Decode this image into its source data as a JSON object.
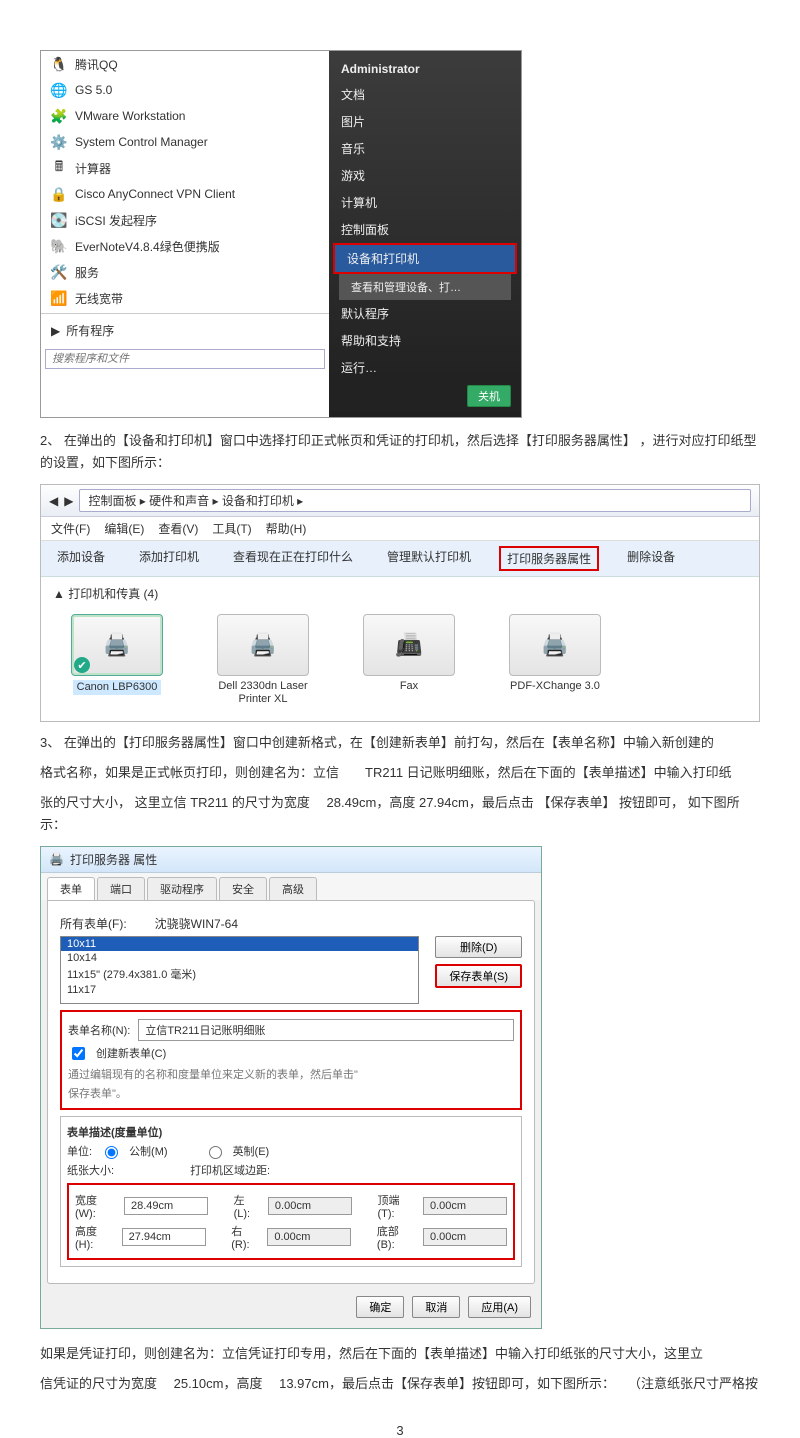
{
  "startmenu": {
    "left": {
      "items": [
        {
          "icon": "🐧",
          "label": "腾讯QQ"
        },
        {
          "icon": "🌐",
          "label": "GS 5.0"
        },
        {
          "icon": "🧩",
          "label": "VMware Workstation"
        },
        {
          "icon": "⚙️",
          "label": "System Control Manager"
        },
        {
          "icon": "🖩",
          "label": "计算器"
        },
        {
          "icon": "🔒",
          "label": "Cisco AnyConnect VPN Client"
        },
        {
          "icon": "💽",
          "label": "iSCSI 发起程序"
        },
        {
          "icon": "🐘",
          "label": "EverNoteV4.8.4绿色便携版"
        },
        {
          "icon": "🛠️",
          "label": "服务"
        },
        {
          "icon": "📶",
          "label": "无线宽带"
        }
      ],
      "allprograms": "所有程序",
      "searchPlaceholder": "搜索程序和文件"
    },
    "right": {
      "user": "Administrator",
      "items": [
        "文档",
        "图片",
        "音乐",
        "游戏",
        "计算机",
        "控制面板"
      ],
      "highlight": "设备和打印机",
      "highlightSub": "查看和管理设备、打…",
      "items2": [
        "默认程序",
        "帮助和支持",
        "运行…"
      ],
      "shutdown": "关机"
    }
  },
  "para2": "2、 在弹出的【设备和打印机】窗口中选择打印正式帐页和凭证的打印机，然后选择【打印服务器属性】 ，进行对应打印纸型的设置，如下图所示：",
  "cp": {
    "path": "控制面板 ▸ 硬件和声音 ▸ 设备和打印机 ▸",
    "menu": [
      "文件(F)",
      "编辑(E)",
      "查看(V)",
      "工具(T)",
      "帮助(H)"
    ],
    "cmds": [
      "添加设备",
      "添加打印机",
      "查看现在正在打印什么",
      "管理默认打印机"
    ],
    "cmdHighlight": "打印服务器属性",
    "cmdAfter": "删除设备",
    "groupTitle": "▲ 打印机和传真 (4)",
    "devices": [
      {
        "icon": "🖨️",
        "label": "Canon LBP6300",
        "sel": true
      },
      {
        "icon": "🖨️",
        "label": "Dell 2330dn Laser Printer XL"
      },
      {
        "icon": "📠",
        "label": "Fax"
      },
      {
        "icon": "🖨️",
        "label": "PDF-XChange 3.0"
      }
    ]
  },
  "para3a": "3、 在弹出的【打印服务器属性】窗口中创建新格式，在【创建新表单】前打勾，然后在【表单名称】中输入新创建的",
  "para3b": "格式名称，如果是正式帐页打印，则创建名为：立信  TR211 日记账明细账，然后在下面的【表单描述】中输入打印纸",
  "para3c": "张的尺寸大小， 这里立信 TR211 的尺寸为宽度  28.49cm，高度 27.94cm，最后点击 【保存表单】 按钮即可， 如下图所示：",
  "psp": {
    "title": "打印服务器 属性",
    "tabs": [
      "表单",
      "端口",
      "驱动程序",
      "安全",
      "高级"
    ],
    "allForms": "所有表单(F):",
    "server": "沈骁骁WIN7-64",
    "list": [
      "10x11",
      "10x14",
      "11x15\" (279.4x381.0 毫米)",
      "11x17"
    ],
    "btnDelete": "删除(D)",
    "btnSave": "保存表单(S)",
    "formNameLabel": "表单名称(N):",
    "formName": "立信TR211日记账明细账",
    "chkNew": "创建新表单(C)",
    "note1": "通过编辑现有的名称和度量单位来定义新的表单，然后单击\"",
    "note2": "保存表单\"。",
    "descTitle": "表单描述(度量单位)",
    "unitLabel": "单位:",
    "unitMetric": "公制(M)",
    "unitEnglish": "英制(E)",
    "paperSize": "纸张大小:",
    "printerArea": "打印机区域边距:",
    "wLabel": "宽度(W):",
    "wVal": "28.49cm",
    "hLabel": "高度(H):",
    "hVal": "27.94cm",
    "lLabel": "左(L):",
    "lVal": "0.00cm",
    "rLabel": "右(R):",
    "rVal": "0.00cm",
    "tLabel": "顶端(T):",
    "tVal": "0.00cm",
    "bLabel": "底部(B):",
    "bVal": "0.00cm",
    "ok": "确定",
    "cancel": "取消",
    "apply": "应用(A)"
  },
  "para4a": "如果是凭证打印，则创建名为：立信凭证打印专用，然后在下面的【表单描述】中输入打印纸张的尺寸大小，这里立",
  "para4b": "信凭证的尺寸为宽度  25.10cm，高度  13.97cm，最后点击【保存表单】按钮即可，如下图所示：　　（注意纸张尺寸严格按",
  "pageNumber": "3"
}
